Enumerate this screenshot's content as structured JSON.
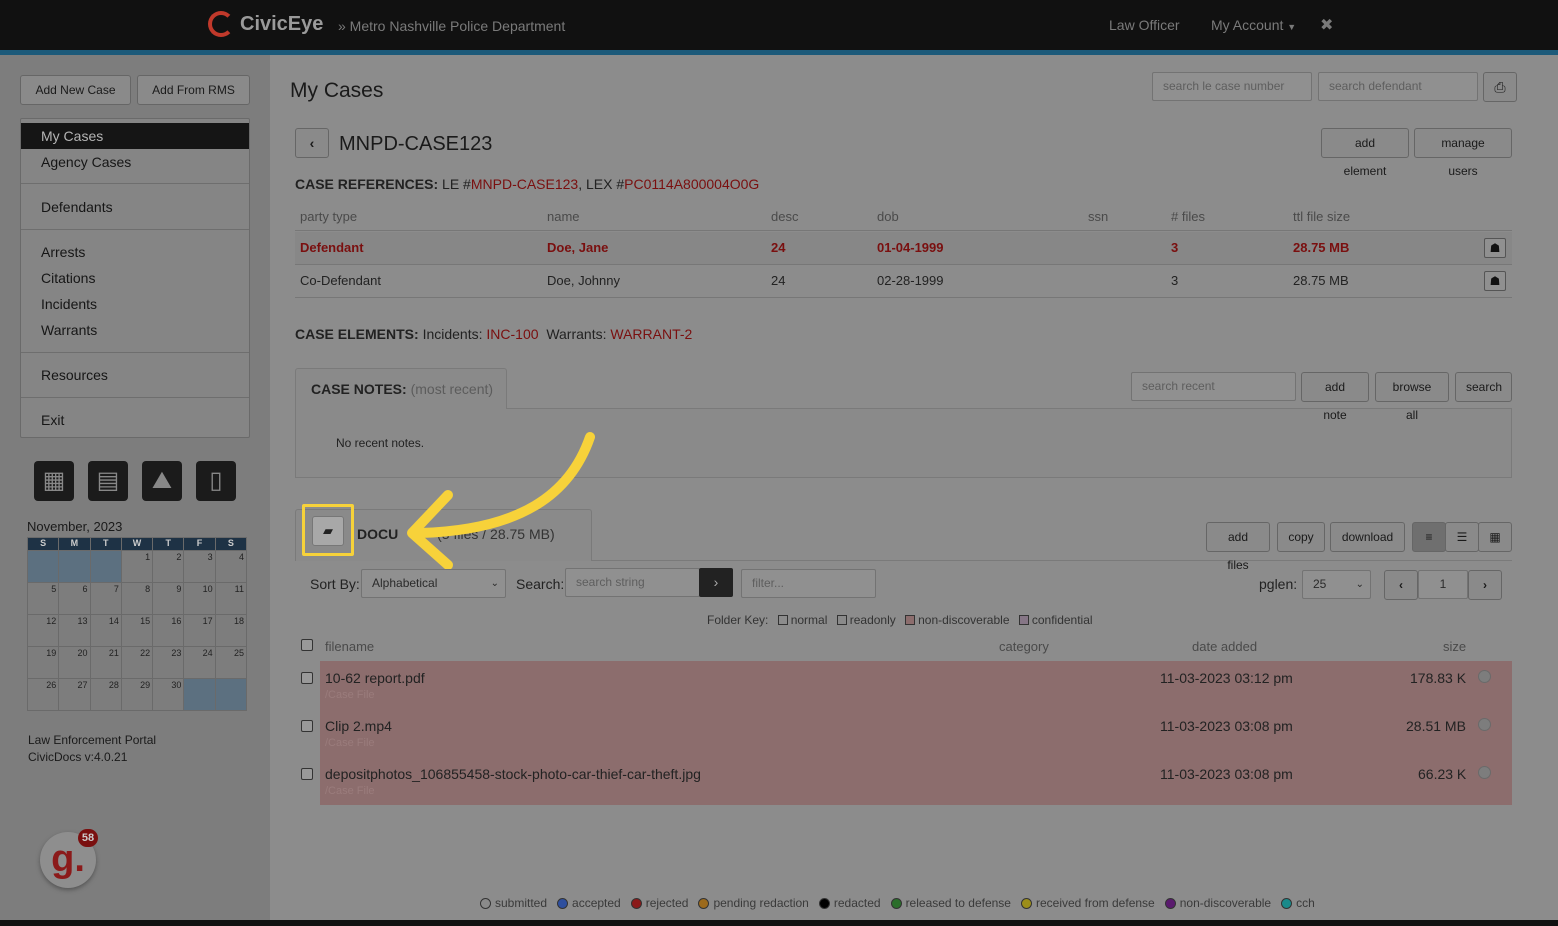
{
  "header": {
    "brand": "CivicEye",
    "department": "» Metro Nashville Police Department",
    "role": "Law Officer",
    "account": "My Account",
    "close_glyph": "✖"
  },
  "sidebar": {
    "add_case": "Add New Case",
    "add_rms": "Add From RMS",
    "items": [
      "My Cases",
      "Agency Cases",
      "Defendants",
      "Arrests",
      "Citations",
      "Incidents",
      "Warrants",
      "Resources",
      "Exit"
    ],
    "calendar_month": "November, 2023",
    "days": [
      "S",
      "M",
      "T",
      "W",
      "T",
      "F",
      "S"
    ],
    "weeks": [
      [
        "",
        "",
        "",
        "1",
        "2",
        "3",
        "4"
      ],
      [
        "5",
        "6",
        "7",
        "8",
        "9",
        "10",
        "11"
      ],
      [
        "12",
        "13",
        "14",
        "15",
        "16",
        "17",
        "18"
      ],
      [
        "19",
        "20",
        "21",
        "22",
        "23",
        "24",
        "25"
      ],
      [
        "26",
        "27",
        "28",
        "29",
        "30",
        "",
        ""
      ]
    ],
    "portal": "Law Enforcement Portal",
    "version": "CivicDocs v:4.0.21",
    "badge": "58",
    "badge_letter": "g."
  },
  "main": {
    "title": "My Cases",
    "search_case_placeholder": "search le case number",
    "search_def_placeholder": "search defendant",
    "case_id": "MNPD-CASE123",
    "add_element": "add element",
    "manage_users": "manage users",
    "refs_label": "CASE REFERENCES:",
    "refs_le": "LE #",
    "refs_le_val": "MNPD-CASE123",
    "refs_lex": ", LEX #",
    "refs_lex_val": "PC0114A800004O0G",
    "party_headers": [
      "party type",
      "name",
      "desc",
      "dob",
      "ssn",
      "# files",
      "ttl file size"
    ],
    "parties": [
      {
        "type": "Defendant",
        "name": "Doe, Jane",
        "desc": "24",
        "dob": "01-04-1999",
        "ssn": "",
        "files": "3",
        "size": "28.75 MB"
      },
      {
        "type": "Co-Defendant",
        "name": "Doe, Johnny",
        "desc": "24",
        "dob": "02-28-1999",
        "ssn": "",
        "files": "3",
        "size": "28.75 MB"
      }
    ],
    "elements_label": "CASE ELEMENTS:",
    "incidents_label": "Incidents:",
    "incidents_val": "INC-100",
    "warrants_label": "Warrants:",
    "warrants_val": "WARRANT-2",
    "notes_label": "CASE NOTES:",
    "notes_sub": "(most recent)",
    "notes_search": "search recent",
    "add_note": "add note",
    "browse_all": "browse all",
    "search": "search",
    "no_notes": "No recent notes.",
    "docs_label": "DOCU",
    "docs_sub": "(3 files / 28.75 MB)",
    "add_files": "add files",
    "copy": "copy",
    "download": "download",
    "sort_by": "Sort By:",
    "sort_value": "Alphabetical",
    "search_label": "Search:",
    "search_string": "search string",
    "filter": "filter...",
    "pglen": "pglen:",
    "pglen_value": "25",
    "page": "1",
    "folder_key": "Folder Key:",
    "keys": [
      "normal",
      "readonly",
      "non-discoverable",
      "confidential"
    ],
    "file_headers": [
      "filename",
      "category",
      "date added",
      "size"
    ],
    "files": [
      {
        "name": "10-62 report.pdf",
        "folder": "/Case File",
        "date": "11-03-2023 03:12 pm",
        "size": "178.83 K"
      },
      {
        "name": "Clip 2.mp4",
        "folder": "/Case File",
        "date": "11-03-2023 03:08 pm",
        "size": "28.51 MB"
      },
      {
        "name": "depositphotos_106855458-stock-photo-car-thief-car-theft.jpg",
        "folder": "/Case File",
        "date": "11-03-2023 03:08 pm",
        "size": "66.23 K"
      }
    ],
    "legend": [
      "submitted",
      "accepted",
      "rejected",
      "pending redaction",
      "redacted",
      "released to defense",
      "received from defense",
      "non-discoverable",
      "cch"
    ]
  },
  "colors": {
    "highlight": "#f7d23a",
    "legend": [
      "#8a8a8a",
      "#2e4f9e",
      "#8b1a1a",
      "#9c6a1c",
      "#000000",
      "#2a6e2a",
      "#9c8e1a",
      "#5a1a6e",
      "#1a8a8a"
    ]
  }
}
